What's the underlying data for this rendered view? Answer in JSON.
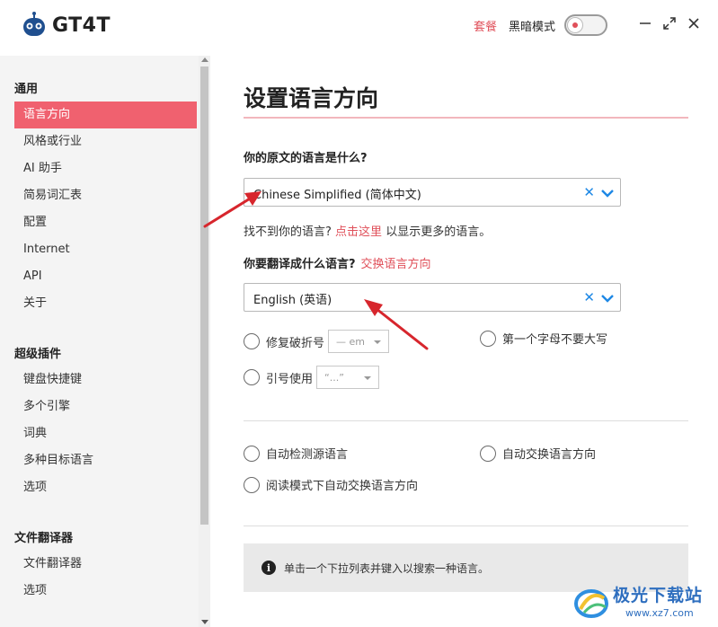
{
  "app": {
    "logo_text": "GT4T",
    "plan_label": "套餐",
    "dark_mode_label": "黑暗模式",
    "dark_mode_on": false
  },
  "sidebar": {
    "groups": [
      {
        "title": "通用",
        "items": [
          "语言方向",
          "风格或行业",
          "AI 助手",
          "简易词汇表",
          "配置",
          "Internet",
          "API",
          "关于"
        ]
      },
      {
        "title": "超级插件",
        "items": [
          "键盘快捷键",
          "多个引擎",
          "词典",
          "多种目标语言",
          "选项"
        ]
      },
      {
        "title": "文件翻译器",
        "items": [
          "文件翻译器",
          "选项"
        ]
      }
    ],
    "active_item": "语言方向"
  },
  "main": {
    "title": "设置语言方向",
    "source_question": "你的原文的语言是什么?",
    "source_value": "Chinese Simplified (简体中文)",
    "hint_prefix": "找不到你的语言?",
    "hint_link": "点击这里",
    "hint_suffix": "以显示更多的语言。",
    "target_question": "你要翻译成什么语言?",
    "swap_link": "交换语言方向",
    "target_value": "English (英语)",
    "options": {
      "fix_hyphen": "修复破折号",
      "fix_hyphen_select": "— em",
      "no_capitalize": "第一个字母不要大写",
      "quotes": "引号使用",
      "quotes_select": "“...”",
      "auto_detect": "自动检测源语言",
      "auto_swap": "自动交换语言方向",
      "reading_mode_swap": "阅读模式下自动交换语言方向"
    },
    "info_text": "单击一个下拉列表并键入以搜索一种语言。"
  },
  "watermark": {
    "title": "极光下载站",
    "url": "www.xz7.com"
  },
  "colors": {
    "accent": "#f0616f",
    "link": "#e0505a",
    "clear_icon": "#1e88e5",
    "arrow": "#d7262d"
  }
}
